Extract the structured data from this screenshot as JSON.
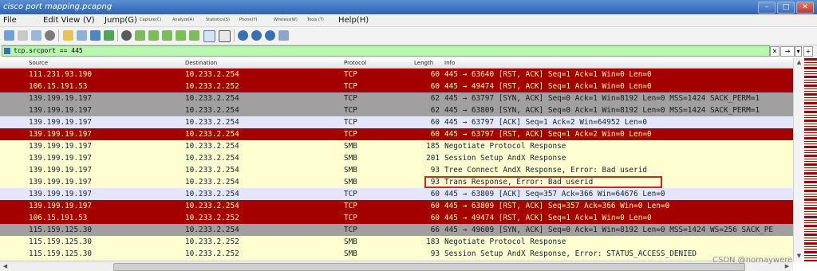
{
  "window": {
    "title": "cisco port mapping.pcapng"
  },
  "menu": {
    "file": "File",
    "edit_view": "Edit View",
    "v": "(V)",
    "jump": "Jump(G)",
    "capture": "Capture(C)",
    "analyze": "Analyze(A)",
    "statistics": "Statistics(S)",
    "phone": "Phone(Y)",
    "wireless": "Wireless(W)",
    "tools": "Tools (T)",
    "help": "Help(H)"
  },
  "filter": {
    "value": "tcp.srcport == 445"
  },
  "columns": {
    "source": "Source",
    "destination": "Destination",
    "protocol": "Protocol",
    "length": "Length",
    "info": "Info"
  },
  "packets": [
    {
      "src": "111.231.93.190",
      "dst": "10.233.2.254",
      "proto": "TCP",
      "len": "60",
      "info": "445 → 63640 [RST, ACK] Seq=1 Ack=1 Win=0 Len=0",
      "style": "black"
    },
    {
      "src": "106.15.191.53",
      "dst": "10.233.2.252",
      "proto": "TCP",
      "len": "60",
      "info": "445 → 49474 [RST, ACK] Seq=1 Ack=1 Win=0 Len=0",
      "style": "black"
    },
    {
      "src": "139.199.19.197",
      "dst": "10.233.2.254",
      "proto": "TCP",
      "len": "62",
      "info": "445 → 63797 [SYN, ACK] Seq=0 Ack=1 Win=8192 Len=0 MSS=1424 SACK_PERM=1",
      "style": "grey"
    },
    {
      "src": "139.199.19.197",
      "dst": "10.233.2.254",
      "proto": "TCP",
      "len": "62",
      "info": "445 → 63809 [SYN, ACK] Seq=0 Ack=1 Win=8192 Len=0 MSS=1424 SACK_PERM=1",
      "style": "grey"
    },
    {
      "src": "139.199.19.197",
      "dst": "10.233.2.254",
      "proto": "TCP",
      "len": "60",
      "info": "445 → 63797 [ACK] Seq=1 Ack=2 Win=64952 Len=0",
      "style": "lav"
    },
    {
      "src": "139.199.19.197",
      "dst": "10.233.2.254",
      "proto": "TCP",
      "len": "60",
      "info": "445 → 63797 [RST, ACK] Seq=1 Ack=2 Win=0 Len=0",
      "style": "black"
    },
    {
      "src": "139.199.19.197",
      "dst": "10.233.2.254",
      "proto": "SMB",
      "len": "185",
      "info": "Negotiate Protocol Response",
      "style": "smb"
    },
    {
      "src": "139.199.19.197",
      "dst": "10.233.2.254",
      "proto": "SMB",
      "len": "201",
      "info": "Session Setup AndX Response",
      "style": "smb"
    },
    {
      "src": "139.199.19.197",
      "dst": "10.233.2.254",
      "proto": "SMB",
      "len": "93",
      "info": "Tree Connect AndX Response, Error: Bad userid",
      "style": "smb"
    },
    {
      "src": "139.199.19.197",
      "dst": "10.233.2.254",
      "proto": "SMB",
      "len": "93",
      "info": "Trans Response, Error: Bad userid",
      "style": "smb"
    },
    {
      "src": "139.199.19.197",
      "dst": "10.233.2.254",
      "proto": "TCP",
      "len": "60",
      "info": "445 → 63809 [ACK] Seq=357 Ack=366 Win=64676 Len=0",
      "style": "lav"
    },
    {
      "src": "139.199.19.197",
      "dst": "10.233.2.254",
      "proto": "TCP",
      "len": "60",
      "info": "445 → 63809 [RST, ACK] Seq=357 Ack=366 Win=0 Len=0",
      "style": "black"
    },
    {
      "src": "106.15.191.53",
      "dst": "10.233.2.252",
      "proto": "TCP",
      "len": "60",
      "info": "445 → 49474 [RST, ACK] Seq=1 Ack=1 Win=0 Len=0",
      "style": "black"
    },
    {
      "src": "115.159.125.30",
      "dst": "10.233.2.254",
      "proto": "TCP",
      "len": "66",
      "info": "445 → 49609 [SYN, ACK] Seq=0 Ack=1 Win=8192 Len=0 MSS=1424 WS=256 SACK_PE",
      "style": "grey"
    },
    {
      "src": "115.159.125.30",
      "dst": "10.233.2.252",
      "proto": "SMB",
      "len": "183",
      "info": "Negotiate Protocol Response",
      "style": "smb"
    },
    {
      "src": "115.159.125.30",
      "dst": "10.233.2.252",
      "proto": "SMB",
      "len": "93",
      "info": "Session Setup AndX Response, Error: STATUS_ACCESS_DENIED",
      "style": "smb"
    }
  ],
  "row_colors": {
    "black": "#a40000",
    "grey": "#a0a0a0",
    "lav": "#e6e6fa",
    "smb": "#feffd0",
    "filter_ok": "#b7f7b0",
    "highlight": "#e02020"
  },
  "watermark": "CSDN @nomaywere"
}
